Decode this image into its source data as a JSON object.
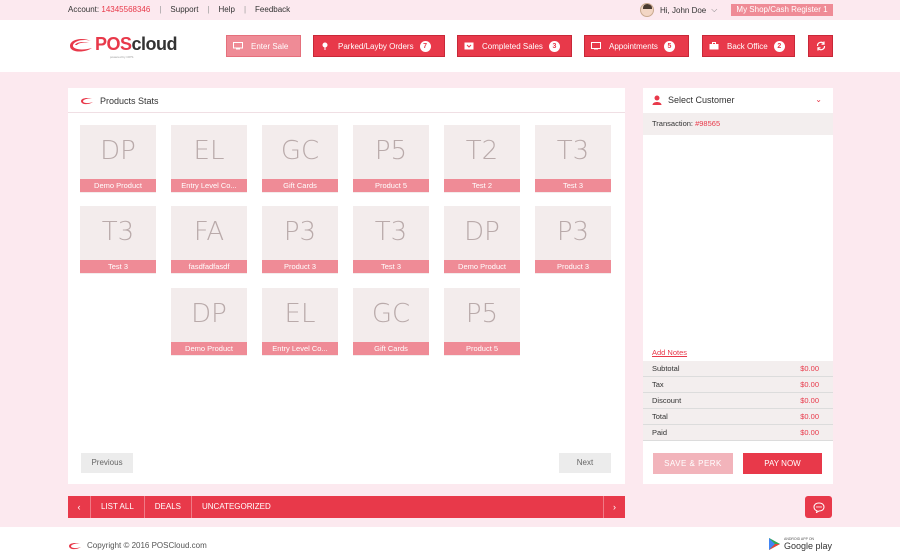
{
  "topbar": {
    "account_label": "Account:",
    "account_number": "14345568346",
    "support": "Support",
    "help": "Help",
    "feedback": "Feedback",
    "user_greeting": "Hi, John Doe",
    "shop_register": "My Shop/Cash Register 1"
  },
  "brand": {
    "logo_pos": "POS",
    "logo_cloud": "cloud",
    "logo_sub": "powered by CIPS",
    "accent_color": "#e8394a",
    "accent_light": "#ef8b96"
  },
  "nav": {
    "enter_sale": "Enter Sale",
    "parked": "Parked/Layby Orders",
    "parked_count": "7",
    "completed": "Completed Sales",
    "completed_count": "3",
    "appointments": "Appointments",
    "appointments_count": "5",
    "back_office": "Back Office",
    "back_office_count": "2"
  },
  "products": {
    "title": "Products Stats",
    "tiles": [
      {
        "abbr": "DP",
        "name": "Demo Product"
      },
      {
        "abbr": "EL",
        "name": "Entry Level Co..."
      },
      {
        "abbr": "GC",
        "name": "Gift Cards"
      },
      {
        "abbr": "P5",
        "name": "Product 5"
      },
      {
        "abbr": "T2",
        "name": "Test 2"
      },
      {
        "abbr": "T3",
        "name": "Test 3"
      },
      {
        "abbr": "T3",
        "name": "Test 3"
      },
      {
        "abbr": "FA",
        "name": "fasdfadfasdf"
      },
      {
        "abbr": "P3",
        "name": "Product 3"
      },
      {
        "abbr": "T3",
        "name": "Test 3"
      },
      {
        "abbr": "DP",
        "name": "Demo Product"
      },
      {
        "abbr": "P3",
        "name": "Product 3"
      },
      {
        "abbr": "DP",
        "name": "Demo Product"
      },
      {
        "abbr": "EL",
        "name": "Entry Level Co..."
      },
      {
        "abbr": "GC",
        "name": "Gift Cards"
      },
      {
        "abbr": "P5",
        "name": "Product 5"
      }
    ],
    "previous": "Previous",
    "next": "Next"
  },
  "categories": {
    "prev_arrow": "‹",
    "next_arrow": "›",
    "list_all": "LIST ALL",
    "deals": "DEALS",
    "uncategorized": "UNCATEGORIZED"
  },
  "customer": {
    "select_customer": "Select Customer",
    "transaction_label": "Transaction:",
    "transaction_id": "#98565",
    "add_notes": "Add Notes",
    "totals": [
      {
        "label": "Subtotal",
        "value": "$0.00"
      },
      {
        "label": "Tax",
        "value": "$0.00"
      },
      {
        "label": "Discount",
        "value": "$0.00"
      },
      {
        "label": "Total",
        "value": "$0.00"
      },
      {
        "label": "Paid",
        "value": "$0.00"
      }
    ],
    "save_perk": "SAVE & PERK",
    "pay_now": "PAY NOW"
  },
  "footer": {
    "copyright": "Copyright © 2016 POSCloud.com",
    "gplay_small": "ANDROID APP ON",
    "gplay_big": "Google play"
  }
}
